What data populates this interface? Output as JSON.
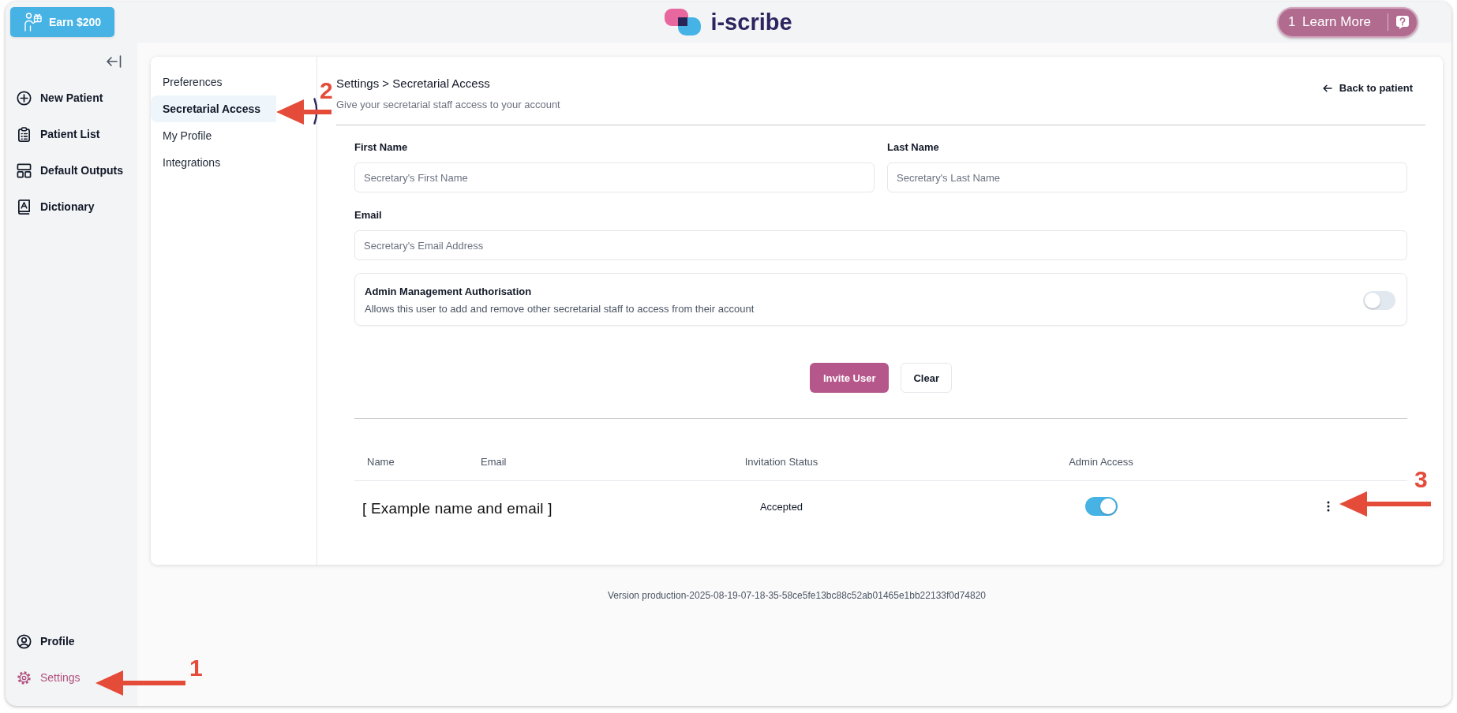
{
  "top_bar": {
    "earn_button": "Earn $200",
    "brand": "i-scribe",
    "learn_more": {
      "count": "1",
      "label": "Learn More"
    }
  },
  "sidebar": {
    "items": [
      {
        "label": "New Patient",
        "selected": false
      },
      {
        "label": "Patient List",
        "selected": false
      },
      {
        "label": "Default Outputs",
        "selected": false
      },
      {
        "label": "Dictionary",
        "selected": false
      }
    ],
    "bottom_items": [
      {
        "label": "Profile",
        "selected": false
      },
      {
        "label": "Settings",
        "selected": true
      }
    ]
  },
  "settings_nav": [
    {
      "label": "Preferences",
      "selected": false
    },
    {
      "label": "Secretarial Access",
      "selected": true
    },
    {
      "label": "My Profile",
      "selected": false
    },
    {
      "label": "Integrations",
      "selected": false
    }
  ],
  "header": {
    "breadcrumb": "Settings > Secretarial Access",
    "subtitle": "Give your secretarial staff access to your account",
    "back_link": "Back to patient"
  },
  "form": {
    "field_rows": [
      [
        {
          "label": "First Name",
          "placeholder": "Secretary's First Name"
        },
        {
          "label": "Last Name",
          "placeholder": "Secretary's Last Name"
        }
      ],
      [
        {
          "label": "Email",
          "placeholder": "Secretary's Email Address"
        }
      ]
    ],
    "admin_option": {
      "title": "Admin Management Authorisation",
      "description": "Allows this user to add and remove other secretarial staff to access from their account",
      "on": false
    },
    "buttons": [
      {
        "label": "Invite User",
        "kind": "primary"
      },
      {
        "label": "Clear",
        "kind": "secondary"
      }
    ]
  },
  "table": {
    "columns": [
      "Name",
      "Email",
      "Invitation Status",
      "Admin Access"
    ],
    "rows": [
      {
        "name_and_email": "[ Example name and email ]",
        "invitation_status": "Accepted",
        "admin_access": true
      }
    ]
  },
  "version": "Version production-2025-08-19-07-18-35-58ce5fe13bc88c52ab01465e1bb22133f0d74820",
  "annotations": [
    {
      "number": "1"
    },
    {
      "number": "2"
    },
    {
      "number": "3"
    }
  ]
}
